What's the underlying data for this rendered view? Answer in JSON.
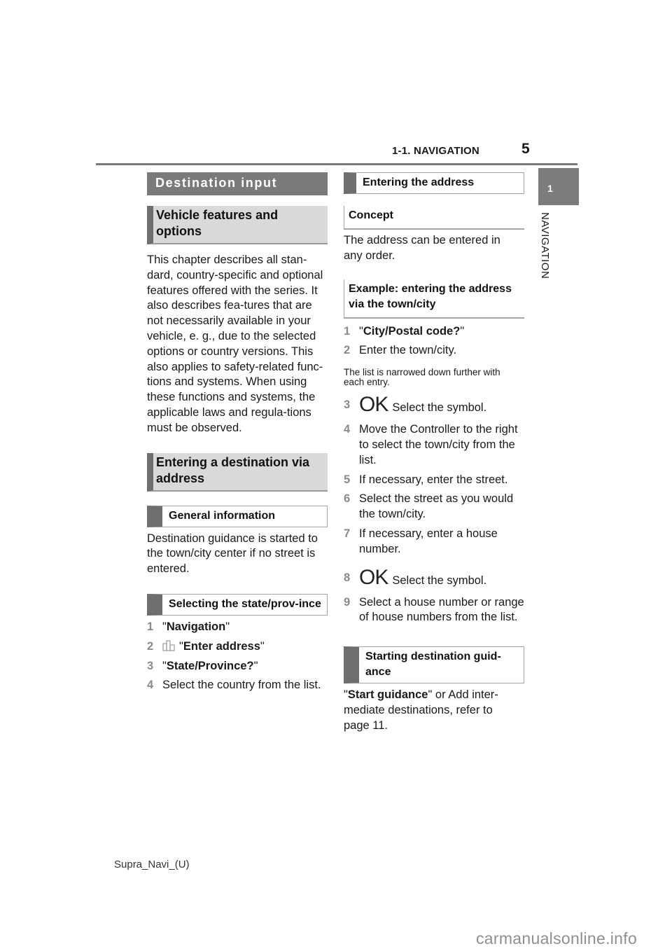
{
  "header": {
    "section": "1-1. NAVIGATION",
    "page_number": "5",
    "chapter_number": "1",
    "chapter_name": "NAVIGATION"
  },
  "left": {
    "destination_input": "Destination input",
    "vehicle_features_heading": "Vehicle features and options",
    "vehicle_features_body": "This chapter describes all stan-dard, country-specific and optional features offered with the series. It also describes fea-tures that are not necessarily available in your vehicle, e. g., due to the selected options or country versions. This also applies to safety-related func-tions and systems. When using these functions and systems, the applicable laws and regula-tions must be observed.",
    "entering_destination_heading": "Entering a destination via address",
    "general_info_heading": "General information",
    "general_info_body": "Destination guidance is started to the town/city center if no street is entered.",
    "state_heading": "Selecting the state/prov-ince",
    "steps": [
      {
        "num": "1",
        "bold": "Navigation",
        "icon": "",
        "text": ""
      },
      {
        "num": "2",
        "bold": "Enter address",
        "icon": "address-building-icon",
        "text": ""
      },
      {
        "num": "3",
        "bold": "State/Province?",
        "icon": "",
        "text": ""
      },
      {
        "num": "4",
        "bold": "",
        "icon": "",
        "text": "Select the country from the list."
      }
    ]
  },
  "right": {
    "entering_address_heading": "Entering the address",
    "concept_heading": "Concept",
    "concept_body": "The address can be entered in any order.",
    "example_heading": "Example: entering the address via the town/city",
    "steps": [
      {
        "num": "1",
        "bold": "City/Postal code?",
        "text": ""
      },
      {
        "num": "2",
        "bold": "",
        "text": "Enter the town/city."
      }
    ],
    "note": "The list is narrowed down further with each entry.",
    "ok_symbol": "OK",
    "steps2": [
      {
        "num": "3",
        "ok": true,
        "text": "Select the symbol."
      },
      {
        "num": "4",
        "text": "Move the Controller to the right to select the town/city from the list."
      },
      {
        "num": "5",
        "text": "If necessary, enter the street."
      },
      {
        "num": "6",
        "text": "Select the street as you would the town/city."
      },
      {
        "num": "7",
        "text": "If necessary, enter a house number."
      },
      {
        "num": "8",
        "ok": true,
        "text": "Select the symbol."
      },
      {
        "num": "9",
        "text": "Select a house number or range of house numbers from the list."
      }
    ],
    "starting_heading": "Starting destination guid-ance",
    "starting_bold": "Start guidance",
    "starting_body": " or Add inter-mediate destinations, refer to page 11."
  },
  "footer": {
    "doc_code": "Supra_Navi_(U)",
    "watermark": "carmanualsonline.info"
  }
}
